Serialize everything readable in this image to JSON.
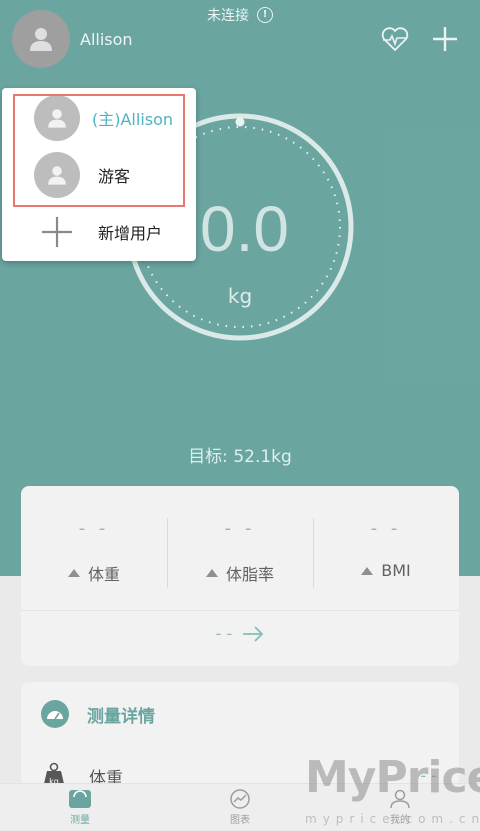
{
  "status": {
    "connection_text": "未连接",
    "info_icon": "info-circle-icon"
  },
  "header": {
    "username": "Allison",
    "avatar_icon": "user-avatar-icon",
    "heart_icon": "heart-rate-icon",
    "add_icon": "plus-icon"
  },
  "gauge": {
    "weight_value": "0.0",
    "unit": "kg"
  },
  "target": {
    "text": "目标: 52.1kg"
  },
  "stats": [
    {
      "value": "- -",
      "label": "体重"
    },
    {
      "value": "- -",
      "label": "体脂率"
    },
    {
      "value": "- -",
      "label": "BMI"
    }
  ],
  "more": {
    "text": "- -",
    "arrow_icon": "arrow-right-icon"
  },
  "detail": {
    "title": "测量详情",
    "row_label": "体重",
    "row_value": "- -"
  },
  "bottom_nav": [
    {
      "label": "测量",
      "icon": "scale-icon",
      "active": true
    },
    {
      "label": "图表",
      "icon": "chart-icon",
      "active": false
    },
    {
      "label": "我的",
      "icon": "profile-icon",
      "active": false
    }
  ],
  "popup": {
    "items": [
      {
        "label": "(主)Allison",
        "icon": "user-avatar-icon"
      },
      {
        "label": "游客",
        "icon": "user-avatar-icon"
      },
      {
        "label": "新增用户",
        "icon": "plus-icon"
      }
    ]
  },
  "watermark": {
    "text": "MyPrice",
    "sub": "myprice.com.cn"
  },
  "colors": {
    "teal": "#4a928c",
    "accent": "#4fb3c4",
    "highlight": "#e8776e"
  }
}
